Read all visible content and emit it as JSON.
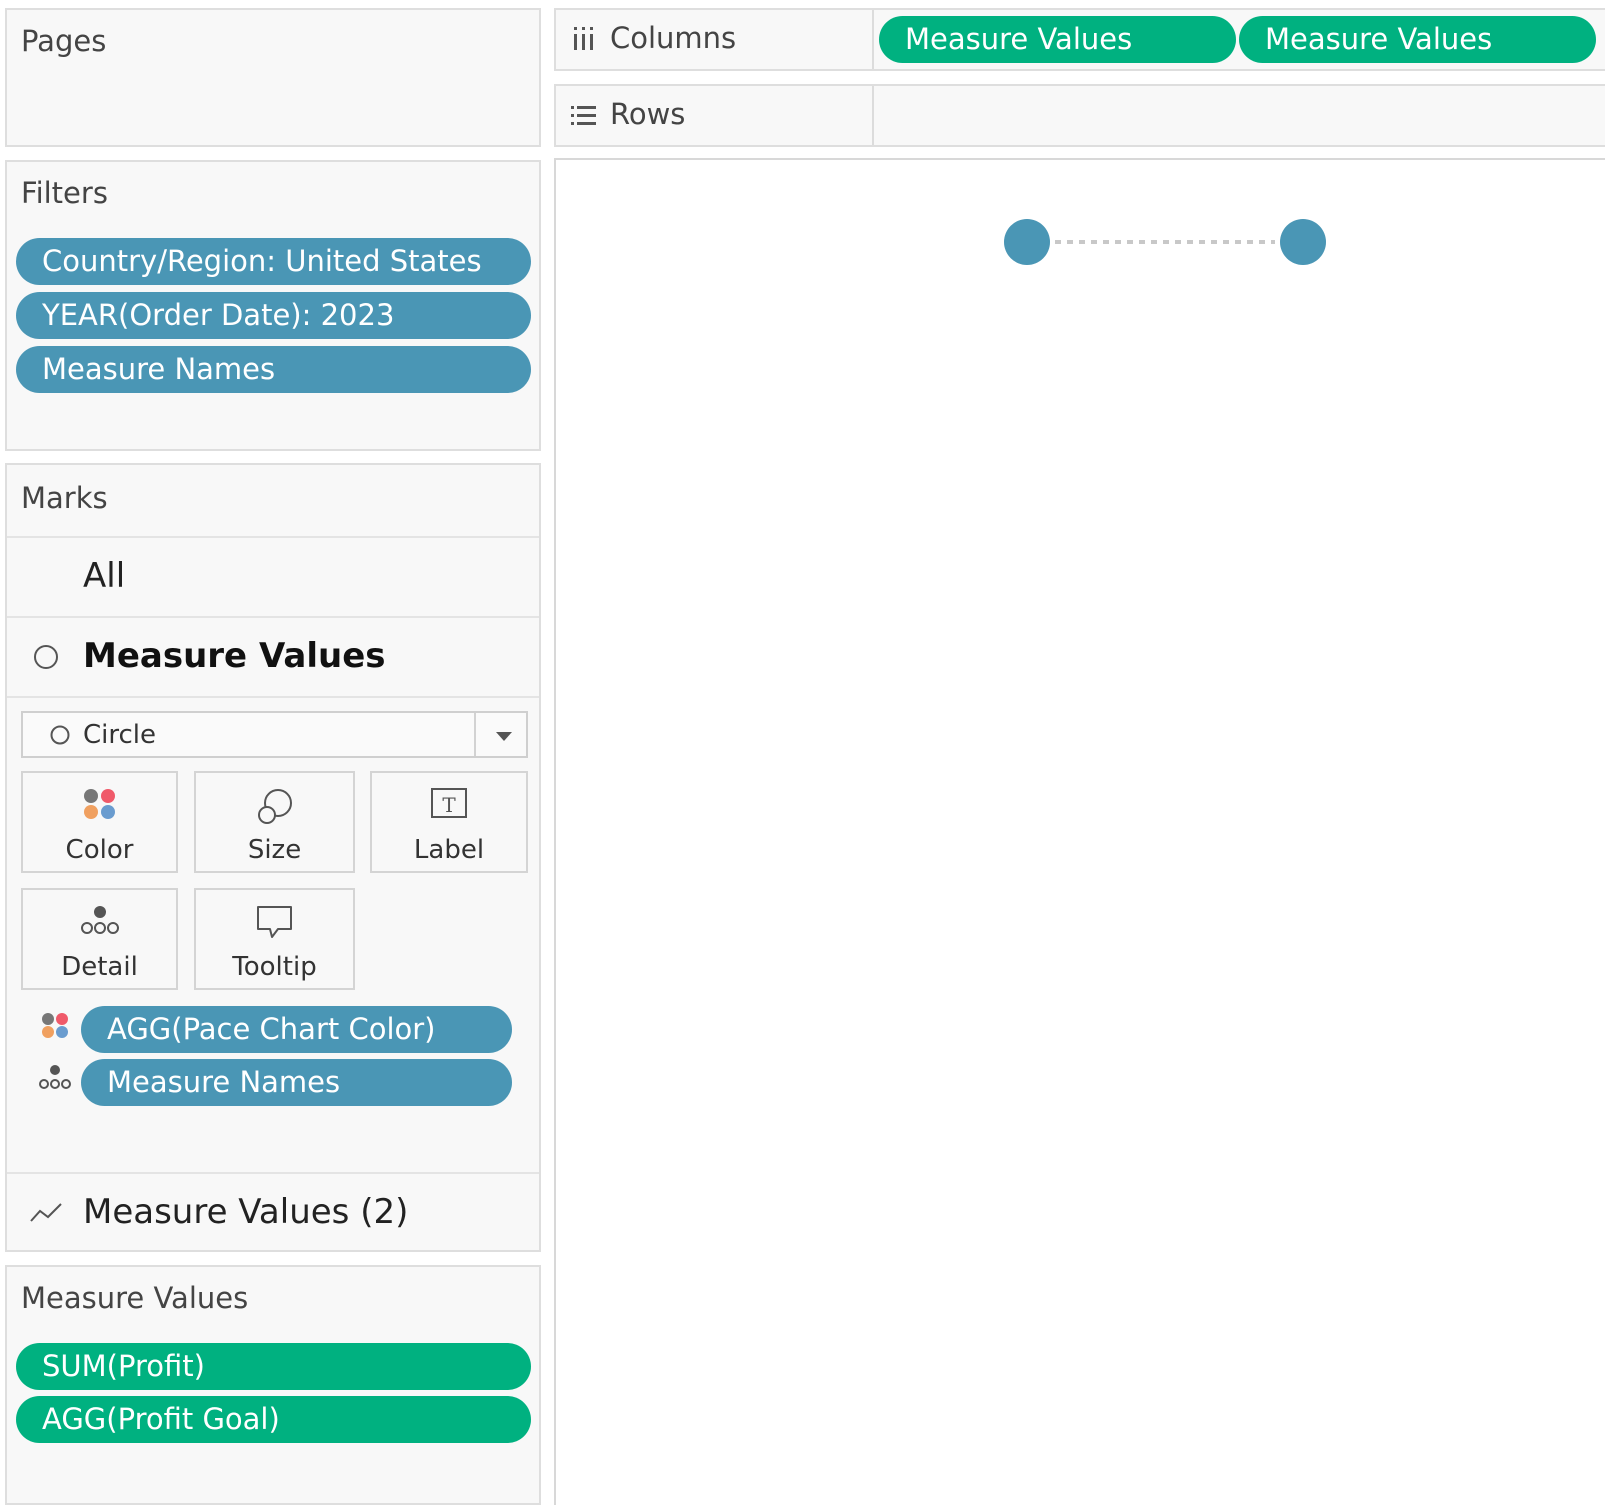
{
  "pages": {
    "title": "Pages"
  },
  "filters": {
    "title": "Filters",
    "items": [
      "Country/Region: United States",
      "YEAR(Order Date): 2023",
      "Measure Names"
    ]
  },
  "marks": {
    "title": "Marks",
    "all_label": "All",
    "card1_label": "Measure Values",
    "card1_icon": "circle-mark-icon",
    "mark_type": "Circle",
    "buttons": {
      "color": "Color",
      "size": "Size",
      "label": "Label",
      "detail": "Detail",
      "tooltip": "Tooltip"
    },
    "assigned": [
      {
        "icon": "color-icon",
        "label": "AGG(Pace Chart Color)"
      },
      {
        "icon": "detail-icon",
        "label": "Measure Names"
      }
    ],
    "card2_label": "Measure Values (2)",
    "card2_icon": "line-mark-icon"
  },
  "measure_values": {
    "title": "Measure Values",
    "items": [
      "SUM(Profit)",
      "AGG(Profit Goal)"
    ]
  },
  "shelves": {
    "columns_label": "Columns",
    "columns_pills": [
      "Measure Values",
      "Measure Values"
    ],
    "rows_label": "Rows"
  },
  "colors": {
    "dimension_pill": "#4a96b5",
    "measure_pill": "#00b180",
    "mark": "#4a96b5",
    "connector": "#c8c8c8"
  },
  "chart_data": {
    "type": "scatter",
    "series": [
      {
        "values": [
          1,
          1
        ]
      }
    ],
    "point_color": "#4a96b5",
    "connector": "dotted",
    "title": "",
    "xlabel": "",
    "ylabel": ""
  }
}
